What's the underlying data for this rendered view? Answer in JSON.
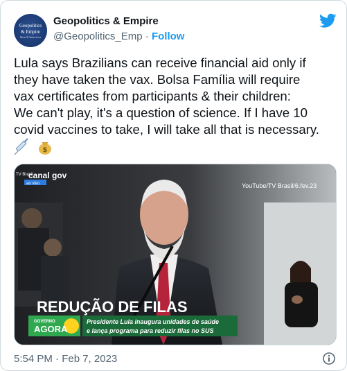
{
  "author": {
    "name": "Geopolitics & Empire",
    "handle": "@Geopolitics_Emp",
    "separator": " · ",
    "follow_label": "Follow",
    "avatar_text_1": "Geopolitics",
    "avatar_text_2": "& Empire",
    "avatar_text_3": "Ideas & Interviews"
  },
  "tweet": {
    "lines": [
      "Lula says Brazilians can receive financial aid only if",
      "they have taken the vax. Bolsa Família will require",
      "vax certificates from participants & their children:",
      "We can't play, it's a question of science. If I have 10",
      "covid vaccines to take, I will take all that is necessary."
    ],
    "emojis": [
      "syringe-emoji",
      "money-bag-emoji"
    ]
  },
  "media": {
    "channel_logo": "canal gov",
    "brasil_label": "TV Brasil",
    "live_label": "ao vivo",
    "source_watermark": "YouTube/TV Brasil/6.fev.23",
    "headline": "REDUÇÃO DE FILAS",
    "program_top": "GOVERNO",
    "program_bottom": "AGORA",
    "ticker_line_1": "Presidente Lula inaugura unidades de saúde",
    "ticker_line_2": "e lança programa para reduzir filas no SUS"
  },
  "footer": {
    "timestamp": "5:54 PM · Feb 7, 2023"
  },
  "colors": {
    "twitter_blue": "#1d9bf0",
    "text_primary": "#0f1419",
    "text_secondary": "#536471",
    "border": "#cfd9de",
    "ticker_green": "#2fa84f",
    "ticker_yellow": "#ffd21f"
  }
}
